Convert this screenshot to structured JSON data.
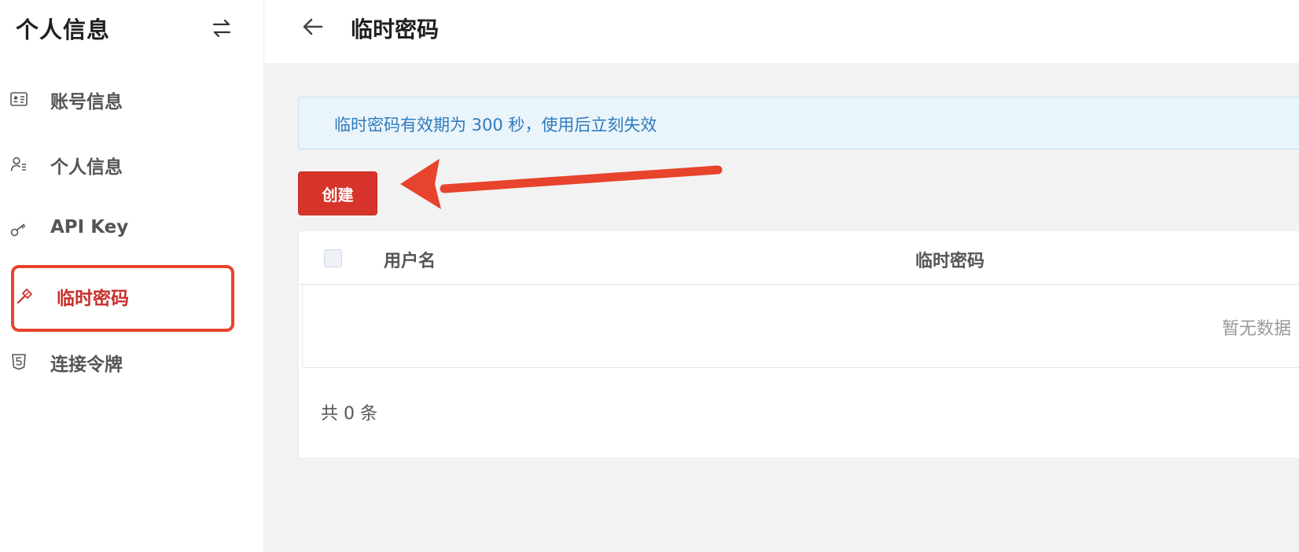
{
  "sidebar": {
    "title": "个人信息",
    "items": [
      {
        "label": "账号信息",
        "icon": "id-card-icon"
      },
      {
        "label": "个人信息",
        "icon": "user-lines-icon"
      },
      {
        "label": "API Key",
        "icon": "key-icon"
      },
      {
        "label": "临时密码",
        "icon": "hammer-icon",
        "active": true
      },
      {
        "label": "连接令牌",
        "icon": "shield-5-icon"
      }
    ]
  },
  "header": {
    "title": "临时密码"
  },
  "notice": {
    "text": "临时密码有效期为 300 秒，使用后立刻失效"
  },
  "actions": {
    "create_label": "创建"
  },
  "table": {
    "columns": [
      "用户名",
      "临时密码"
    ],
    "empty_text": "暂无数据",
    "total_text": "共 0 条"
  },
  "colors": {
    "accent": "#d6342b",
    "annotation": "#e8432c",
    "info_text": "#2f7bbd"
  }
}
